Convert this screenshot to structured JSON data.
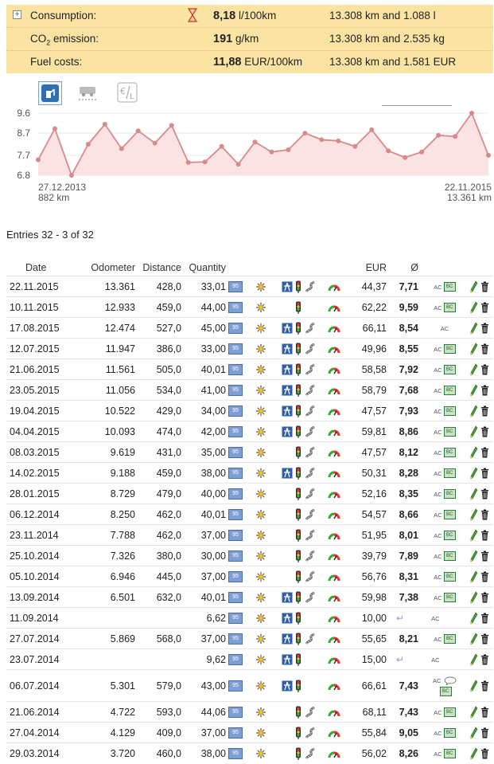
{
  "summary": {
    "consumption": {
      "label": "Consumption:",
      "value": "8,18",
      "unit": "l/100km",
      "detail": "13.308 km and 1.088 l"
    },
    "co2": {
      "label_pre": "CO",
      "label_sub": "2",
      "label_post": " emission:",
      "value": "191",
      "unit": "g/km",
      "detail": "13.308 km and 2.535 kg"
    },
    "costs": {
      "label": "Fuel costs:",
      "value": "11,88",
      "unit": "EUR/100km",
      "detail": "13.308 km and 1.581 EUR"
    }
  },
  "chart_data": {
    "type": "line",
    "x_start_label": "27.12.2013",
    "x_start_km": "882 km",
    "x_end_label": "22.11.2015",
    "x_end_km": "13.361 km",
    "y_ticks": [
      "9.6",
      "8.7",
      "7.7",
      "6.8"
    ],
    "ylim": [
      6.8,
      9.6
    ],
    "values": [
      7.5,
      8.9,
      6.8,
      8.2,
      9.1,
      8.0,
      8.8,
      8.25,
      9.05,
      7.38,
      7.4,
      8.1,
      7.3,
      8.3,
      7.85,
      7.95,
      8.7,
      8.4,
      8.35,
      8.1,
      8.85,
      7.9,
      7.6,
      7.85,
      8.6,
      8.55,
      9.6,
      7.7
    ],
    "line_color": "#d88a8a",
    "fill_color": "#fbe3e3"
  },
  "entries_title": "Entries 32 - 3 of 32",
  "columns": {
    "date": "Date",
    "odometer": "Odometer",
    "distance": "Distance",
    "quantity": "Quantity",
    "eur": "EUR",
    "avg": "Ø"
  },
  "labels": {
    "fuel": "95",
    "ac": "AC",
    "bc": "BC",
    "return": "↵"
  },
  "rows": [
    {
      "date": "22.11.2015",
      "odo": "13.361",
      "dist": "428,0",
      "qty": "33,01",
      "eur": "44,37",
      "avg": "7,71",
      "hw": true,
      "city": true,
      "country": true,
      "gauge": true,
      "bc": true,
      "note": false,
      "ret": false
    },
    {
      "date": "10.11.2015",
      "odo": "12.933",
      "dist": "459,0",
      "qty": "44,00",
      "eur": "62,22",
      "avg": "9,59",
      "hw": false,
      "city": true,
      "country": false,
      "gauge": true,
      "bc": true,
      "note": false,
      "ret": false
    },
    {
      "date": "17.08.2015",
      "odo": "12.474",
      "dist": "527,0",
      "qty": "45,00",
      "eur": "66,11",
      "avg": "8,54",
      "hw": true,
      "city": true,
      "country": true,
      "gauge": true,
      "bc": false,
      "note": false,
      "ret": false
    },
    {
      "date": "12.07.2015",
      "odo": "11.947",
      "dist": "386,0",
      "qty": "33,00",
      "eur": "49,96",
      "avg": "8,55",
      "hw": true,
      "city": true,
      "country": true,
      "gauge": true,
      "bc": true,
      "note": false,
      "ret": false
    },
    {
      "date": "21.06.2015",
      "odo": "11.561",
      "dist": "505,0",
      "qty": "40,01",
      "eur": "58,58",
      "avg": "7,92",
      "hw": true,
      "city": true,
      "country": true,
      "gauge": true,
      "bc": true,
      "note": false,
      "ret": false
    },
    {
      "date": "23.05.2015",
      "odo": "11.056",
      "dist": "534,0",
      "qty": "41,00",
      "eur": "58,79",
      "avg": "7,68",
      "hw": true,
      "city": true,
      "country": true,
      "gauge": true,
      "bc": true,
      "note": false,
      "ret": false
    },
    {
      "date": "19.04.2015",
      "odo": "10.522",
      "dist": "429,0",
      "qty": "34,00",
      "eur": "47,57",
      "avg": "7,93",
      "hw": true,
      "city": true,
      "country": true,
      "gauge": true,
      "bc": true,
      "note": false,
      "ret": false
    },
    {
      "date": "04.04.2015",
      "odo": "10.093",
      "dist": "474,0",
      "qty": "42,00",
      "eur": "59,81",
      "avg": "8,86",
      "hw": true,
      "city": true,
      "country": true,
      "gauge": true,
      "bc": true,
      "note": false,
      "ret": false
    },
    {
      "date": "08.03.2015",
      "odo": "9.619",
      "dist": "431,0",
      "qty": "35,00",
      "eur": "47,57",
      "avg": "8,12",
      "hw": false,
      "city": true,
      "country": true,
      "gauge": true,
      "bc": true,
      "note": false,
      "ret": false
    },
    {
      "date": "14.02.2015",
      "odo": "9.188",
      "dist": "459,0",
      "qty": "38,00",
      "eur": "50,31",
      "avg": "8,28",
      "hw": true,
      "city": true,
      "country": true,
      "gauge": true,
      "bc": true,
      "note": false,
      "ret": false
    },
    {
      "date": "28.01.2015",
      "odo": "8.729",
      "dist": "479,0",
      "qty": "40,00",
      "eur": "52,16",
      "avg": "8,35",
      "hw": false,
      "city": true,
      "country": true,
      "gauge": true,
      "bc": true,
      "note": false,
      "ret": false
    },
    {
      "date": "06.12.2014",
      "odo": "8.250",
      "dist": "462,0",
      "qty": "40,01",
      "eur": "54,57",
      "avg": "8,66",
      "hw": false,
      "city": true,
      "country": true,
      "gauge": true,
      "bc": true,
      "note": false,
      "ret": false
    },
    {
      "date": "23.11.2014",
      "odo": "7.788",
      "dist": "462,0",
      "qty": "37,00",
      "eur": "51,95",
      "avg": "8,01",
      "hw": false,
      "city": true,
      "country": true,
      "gauge": true,
      "bc": true,
      "note": false,
      "ret": false
    },
    {
      "date": "25.10.2014",
      "odo": "7.326",
      "dist": "380,0",
      "qty": "30,00",
      "eur": "39,79",
      "avg": "7,89",
      "hw": false,
      "city": true,
      "country": true,
      "gauge": true,
      "bc": true,
      "note": false,
      "ret": false
    },
    {
      "date": "05.10.2014",
      "odo": "6.946",
      "dist": "445,0",
      "qty": "37,00",
      "eur": "56,76",
      "avg": "8,31",
      "hw": false,
      "city": true,
      "country": true,
      "gauge": true,
      "bc": true,
      "note": false,
      "ret": false
    },
    {
      "date": "13.09.2014",
      "odo": "6.501",
      "dist": "632,0",
      "qty": "40,01",
      "eur": "59,98",
      "avg": "7,38",
      "hw": true,
      "city": true,
      "country": true,
      "gauge": true,
      "bc": true,
      "note": false,
      "ret": false
    },
    {
      "date": "11.09.2014",
      "odo": "",
      "dist": "",
      "qty": "6,62",
      "eur": "10,00",
      "avg": "",
      "hw": true,
      "city": true,
      "country": false,
      "gauge": true,
      "bc": false,
      "note": false,
      "ret": true
    },
    {
      "date": "27.07.2014",
      "odo": "5.869",
      "dist": "568,0",
      "qty": "37,00",
      "eur": "55,65",
      "avg": "8,21",
      "hw": true,
      "city": true,
      "country": true,
      "gauge": true,
      "bc": true,
      "note": false,
      "ret": false
    },
    {
      "date": "23.07.2014",
      "odo": "",
      "dist": "",
      "qty": "9,62",
      "eur": "15,00",
      "avg": "",
      "hw": true,
      "city": true,
      "country": false,
      "gauge": true,
      "bc": false,
      "note": false,
      "ret": true
    },
    {
      "date": "06.07.2014",
      "odo": "5.301",
      "dist": "579,0",
      "qty": "43,00",
      "eur": "66,61",
      "avg": "7,43",
      "hw": true,
      "city": true,
      "country": false,
      "gauge": true,
      "bc": true,
      "note": true,
      "ret": false
    },
    {
      "date": "21.06.2014",
      "odo": "4.722",
      "dist": "593,0",
      "qty": "44,06",
      "eur": "68,11",
      "avg": "7,43",
      "hw": false,
      "city": true,
      "country": true,
      "gauge": true,
      "bc": true,
      "note": false,
      "ret": false
    },
    {
      "date": "27.04.2014",
      "odo": "4.129",
      "dist": "409,0",
      "qty": "37,00",
      "eur": "55,84",
      "avg": "9,05",
      "hw": false,
      "city": true,
      "country": true,
      "gauge": true,
      "bc": true,
      "note": false,
      "ret": false
    },
    {
      "date": "29.03.2014",
      "odo": "3.720",
      "dist": "460,0",
      "qty": "38,00",
      "eur": "56,02",
      "avg": "8,26",
      "hw": false,
      "city": true,
      "country": true,
      "gauge": true,
      "bc": true,
      "note": false,
      "ret": false
    }
  ]
}
